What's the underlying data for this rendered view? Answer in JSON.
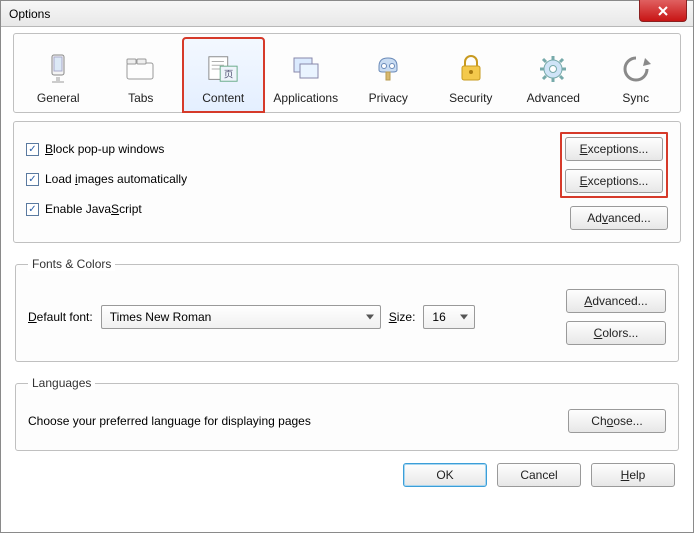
{
  "window": {
    "title": "Options"
  },
  "tabs": {
    "general": "General",
    "tabs": "Tabs",
    "content": "Content",
    "applications": "Applications",
    "privacy": "Privacy",
    "security": "Security",
    "advanced": "Advanced",
    "sync": "Sync",
    "active": "content"
  },
  "content_panel": {
    "block_popups": {
      "label": "Block pop-up windows",
      "checked": true,
      "button": "Exceptions..."
    },
    "load_images": {
      "label": "Load images automatically",
      "checked": true,
      "button": "Exceptions..."
    },
    "enable_js": {
      "label": "Enable JavaScript",
      "checked": true,
      "button": "Advanced..."
    }
  },
  "fonts": {
    "legend": "Fonts & Colors",
    "default_font_label": "Default font:",
    "default_font_value": "Times New Roman",
    "size_label": "Size:",
    "size_value": "16",
    "advanced_button": "Advanced...",
    "colors_button": "Colors..."
  },
  "languages": {
    "legend": "Languages",
    "desc": "Choose your preferred language for displaying pages",
    "choose_button": "Choose..."
  },
  "buttons": {
    "ok": "OK",
    "cancel": "Cancel",
    "help": "Help"
  }
}
